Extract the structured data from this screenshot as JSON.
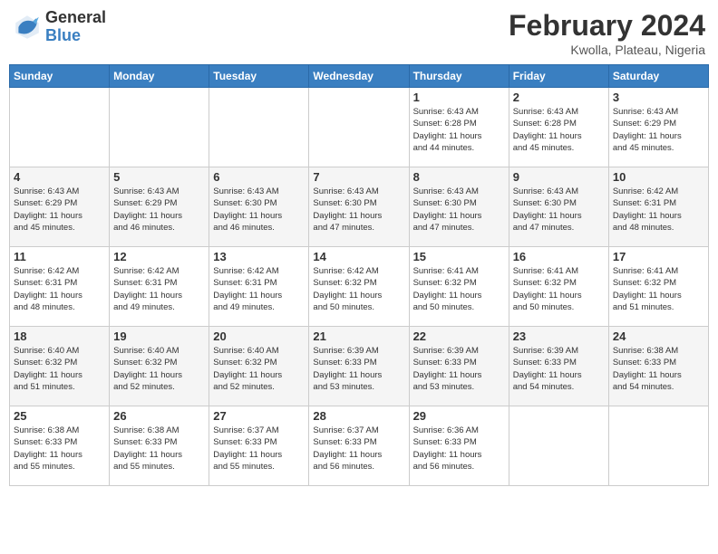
{
  "logo": {
    "general": "General",
    "blue": "Blue"
  },
  "title": {
    "month_year": "February 2024",
    "location": "Kwolla, Plateau, Nigeria"
  },
  "weekdays": [
    "Sunday",
    "Monday",
    "Tuesday",
    "Wednesday",
    "Thursday",
    "Friday",
    "Saturday"
  ],
  "weeks": [
    [
      {
        "day": "",
        "info": ""
      },
      {
        "day": "",
        "info": ""
      },
      {
        "day": "",
        "info": ""
      },
      {
        "day": "",
        "info": ""
      },
      {
        "day": "1",
        "info": "Sunrise: 6:43 AM\nSunset: 6:28 PM\nDaylight: 11 hours\nand 44 minutes."
      },
      {
        "day": "2",
        "info": "Sunrise: 6:43 AM\nSunset: 6:28 PM\nDaylight: 11 hours\nand 45 minutes."
      },
      {
        "day": "3",
        "info": "Sunrise: 6:43 AM\nSunset: 6:29 PM\nDaylight: 11 hours\nand 45 minutes."
      }
    ],
    [
      {
        "day": "4",
        "info": "Sunrise: 6:43 AM\nSunset: 6:29 PM\nDaylight: 11 hours\nand 45 minutes."
      },
      {
        "day": "5",
        "info": "Sunrise: 6:43 AM\nSunset: 6:29 PM\nDaylight: 11 hours\nand 46 minutes."
      },
      {
        "day": "6",
        "info": "Sunrise: 6:43 AM\nSunset: 6:30 PM\nDaylight: 11 hours\nand 46 minutes."
      },
      {
        "day": "7",
        "info": "Sunrise: 6:43 AM\nSunset: 6:30 PM\nDaylight: 11 hours\nand 47 minutes."
      },
      {
        "day": "8",
        "info": "Sunrise: 6:43 AM\nSunset: 6:30 PM\nDaylight: 11 hours\nand 47 minutes."
      },
      {
        "day": "9",
        "info": "Sunrise: 6:43 AM\nSunset: 6:30 PM\nDaylight: 11 hours\nand 47 minutes."
      },
      {
        "day": "10",
        "info": "Sunrise: 6:42 AM\nSunset: 6:31 PM\nDaylight: 11 hours\nand 48 minutes."
      }
    ],
    [
      {
        "day": "11",
        "info": "Sunrise: 6:42 AM\nSunset: 6:31 PM\nDaylight: 11 hours\nand 48 minutes."
      },
      {
        "day": "12",
        "info": "Sunrise: 6:42 AM\nSunset: 6:31 PM\nDaylight: 11 hours\nand 49 minutes."
      },
      {
        "day": "13",
        "info": "Sunrise: 6:42 AM\nSunset: 6:31 PM\nDaylight: 11 hours\nand 49 minutes."
      },
      {
        "day": "14",
        "info": "Sunrise: 6:42 AM\nSunset: 6:32 PM\nDaylight: 11 hours\nand 50 minutes."
      },
      {
        "day": "15",
        "info": "Sunrise: 6:41 AM\nSunset: 6:32 PM\nDaylight: 11 hours\nand 50 minutes."
      },
      {
        "day": "16",
        "info": "Sunrise: 6:41 AM\nSunset: 6:32 PM\nDaylight: 11 hours\nand 50 minutes."
      },
      {
        "day": "17",
        "info": "Sunrise: 6:41 AM\nSunset: 6:32 PM\nDaylight: 11 hours\nand 51 minutes."
      }
    ],
    [
      {
        "day": "18",
        "info": "Sunrise: 6:40 AM\nSunset: 6:32 PM\nDaylight: 11 hours\nand 51 minutes."
      },
      {
        "day": "19",
        "info": "Sunrise: 6:40 AM\nSunset: 6:32 PM\nDaylight: 11 hours\nand 52 minutes."
      },
      {
        "day": "20",
        "info": "Sunrise: 6:40 AM\nSunset: 6:32 PM\nDaylight: 11 hours\nand 52 minutes."
      },
      {
        "day": "21",
        "info": "Sunrise: 6:39 AM\nSunset: 6:33 PM\nDaylight: 11 hours\nand 53 minutes."
      },
      {
        "day": "22",
        "info": "Sunrise: 6:39 AM\nSunset: 6:33 PM\nDaylight: 11 hours\nand 53 minutes."
      },
      {
        "day": "23",
        "info": "Sunrise: 6:39 AM\nSunset: 6:33 PM\nDaylight: 11 hours\nand 54 minutes."
      },
      {
        "day": "24",
        "info": "Sunrise: 6:38 AM\nSunset: 6:33 PM\nDaylight: 11 hours\nand 54 minutes."
      }
    ],
    [
      {
        "day": "25",
        "info": "Sunrise: 6:38 AM\nSunset: 6:33 PM\nDaylight: 11 hours\nand 55 minutes."
      },
      {
        "day": "26",
        "info": "Sunrise: 6:38 AM\nSunset: 6:33 PM\nDaylight: 11 hours\nand 55 minutes."
      },
      {
        "day": "27",
        "info": "Sunrise: 6:37 AM\nSunset: 6:33 PM\nDaylight: 11 hours\nand 55 minutes."
      },
      {
        "day": "28",
        "info": "Sunrise: 6:37 AM\nSunset: 6:33 PM\nDaylight: 11 hours\nand 56 minutes."
      },
      {
        "day": "29",
        "info": "Sunrise: 6:36 AM\nSunset: 6:33 PM\nDaylight: 11 hours\nand 56 minutes."
      },
      {
        "day": "",
        "info": ""
      },
      {
        "day": "",
        "info": ""
      }
    ]
  ]
}
